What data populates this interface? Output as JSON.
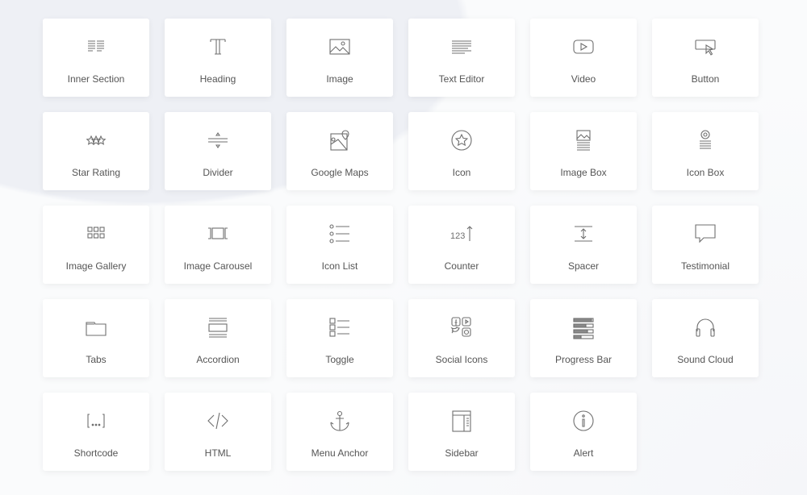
{
  "widgets": [
    {
      "label": "Inner Section",
      "icon": "columns-icon"
    },
    {
      "label": "Heading",
      "icon": "heading-icon"
    },
    {
      "label": "Image",
      "icon": "image-icon"
    },
    {
      "label": "Text Editor",
      "icon": "text-editor-icon"
    },
    {
      "label": "Video",
      "icon": "video-icon"
    },
    {
      "label": "Button",
      "icon": "button-icon"
    },
    {
      "label": "Star Rating",
      "icon": "star-rating-icon"
    },
    {
      "label": "Divider",
      "icon": "divider-icon"
    },
    {
      "label": "Google Maps",
      "icon": "map-icon"
    },
    {
      "label": "Icon",
      "icon": "star-circle-icon"
    },
    {
      "label": "Image Box",
      "icon": "image-box-icon"
    },
    {
      "label": "Icon Box",
      "icon": "icon-box-icon"
    },
    {
      "label": "Image Gallery",
      "icon": "gallery-icon"
    },
    {
      "label": "Image Carousel",
      "icon": "carousel-icon"
    },
    {
      "label": "Icon List",
      "icon": "icon-list-icon"
    },
    {
      "label": "Counter",
      "icon": "counter-icon"
    },
    {
      "label": "Spacer",
      "icon": "spacer-icon"
    },
    {
      "label": "Testimonial",
      "icon": "speech-bubble-icon"
    },
    {
      "label": "Tabs",
      "icon": "tabs-icon"
    },
    {
      "label": "Accordion",
      "icon": "accordion-icon"
    },
    {
      "label": "Toggle",
      "icon": "toggle-icon"
    },
    {
      "label": "Social Icons",
      "icon": "social-icons-icon"
    },
    {
      "label": "Progress Bar",
      "icon": "progress-bar-icon"
    },
    {
      "label": "Sound Cloud",
      "icon": "headphones-icon"
    },
    {
      "label": "Shortcode",
      "icon": "shortcode-icon"
    },
    {
      "label": "HTML",
      "icon": "code-icon"
    },
    {
      "label": "Menu Anchor",
      "icon": "anchor-icon"
    },
    {
      "label": "Sidebar",
      "icon": "sidebar-icon"
    },
    {
      "label": "Alert",
      "icon": "info-icon"
    }
  ],
  "icon_color": "#6f6f6f",
  "label_color": "#555555"
}
